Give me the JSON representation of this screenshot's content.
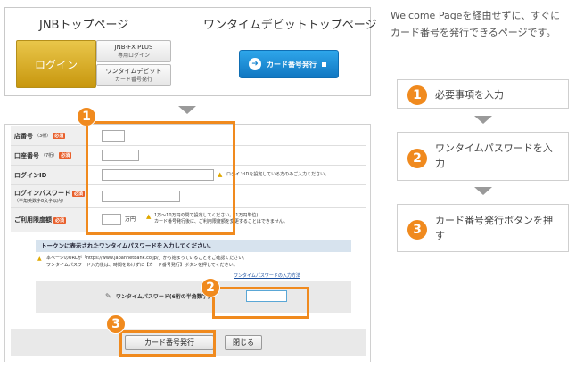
{
  "top": {
    "jnb_title": "JNBトップページ",
    "onetime_title": "ワンタイムデビットトップページ",
    "login_label": "ログイン",
    "fx_label": "JNB-FX PLUS",
    "fx_sub": "専用ログイン",
    "onetime_label": "ワンタイムデビット",
    "onetime_sub": "カード番号発行",
    "card_issue_label": "カード番号発行"
  },
  "form": {
    "rows": [
      {
        "label": "店番号",
        "hint": "（3桁）",
        "req": "必須"
      },
      {
        "label": "口座番号",
        "hint": "（7桁）",
        "req": "必須"
      },
      {
        "label": "ログインID",
        "hint": "",
        "req": ""
      },
      {
        "label": "ログインパスワード",
        "hint": "（半角英数字8文字以内）",
        "req": "必須"
      },
      {
        "label": "ご利用限度額",
        "hint": "",
        "req": "必須"
      }
    ],
    "login_id_note": "ログインIDを設定している方のみご入力ください。",
    "limit_unit": "万円",
    "limit_note_1": "1万～10万円の間で設定してください。(1万円単位)",
    "limit_note_2": "カード番号発行後に、ご利用限度額を変更することはできません。",
    "otp_header": "トークンに表示されたワンタイムパスワードを入力してください。",
    "otp_note_1": "本ページのURLが「https://www.japannetbank.co.jp/」から始まっていることをご確認ください。",
    "otp_note_2": "ワンタイムパスワード入力後は、時間をあけずに【カード番号発行】ボタンを押してください。",
    "otp_link": "ワンタイムパスワードの入力方法",
    "otp_label": "ワンタイムパスワード(6桁の半角数字)",
    "issue_button": "カード番号発行",
    "close_button": "閉じる"
  },
  "badges": {
    "b1": "1",
    "b2": "2",
    "b3": "3"
  },
  "right": {
    "intro": "Welcome Pageを経由せずに、すぐにカード番号を発行できるページです。",
    "steps": [
      {
        "num": "1",
        "text": "必要事項を入力"
      },
      {
        "num": "2",
        "text": "ワンタイムパスワードを入力"
      },
      {
        "num": "3",
        "text": "カード番号発行ボタンを押す"
      }
    ]
  },
  "colors": {
    "accent_orange": "#f08a1e",
    "login_gold": "#d4a21c",
    "issue_blue": "#1a86d0"
  }
}
